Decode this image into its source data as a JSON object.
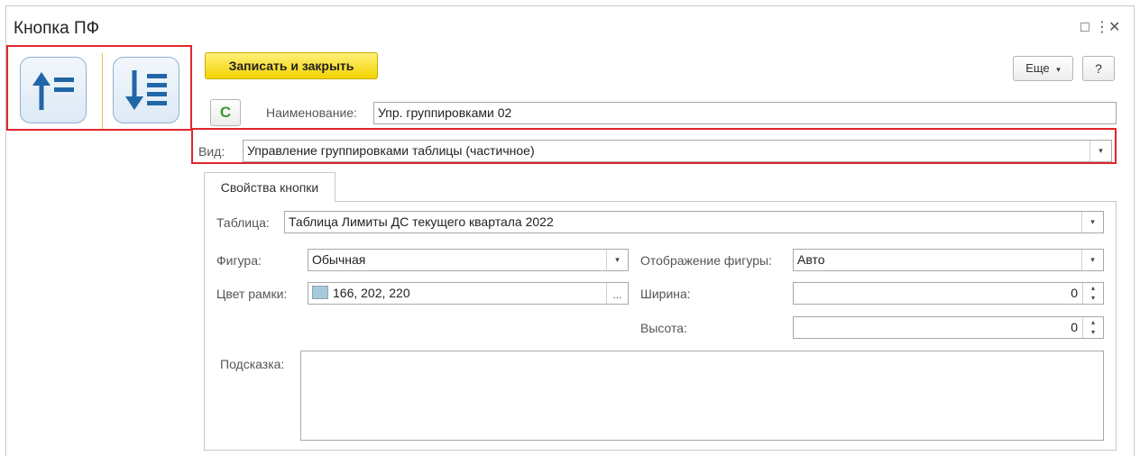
{
  "window": {
    "title": "Кнопка ПФ",
    "more_glyph": "⋮",
    "maximize_glyph": "□",
    "close_glyph": "✕"
  },
  "toolbar": {
    "save_close_label": "Записать и закрыть",
    "more_label": "Еще",
    "more_arrow": "▾",
    "help_label": "?",
    "refresh_glyph": "C"
  },
  "form": {
    "name_label": "Наименование:",
    "name_value": "Упр. группировками 02",
    "type_label": "Вид:",
    "type_value": "Управление группировками таблицы (частичное)"
  },
  "tabs": [
    {
      "label": "Свойства кнопки"
    }
  ],
  "properties": {
    "table_label": "Таблица:",
    "table_value": "Таблица Лимиты ДС текущего квартала 2022",
    "shape_label": "Фигура:",
    "shape_value": "Обычная",
    "shape_display_label": "Отображение фигуры:",
    "shape_display_value": "Авто",
    "border_color_label": "Цвет рамки:",
    "border_color_value": "166, 202, 220",
    "border_color_swatch": "#a6cadc",
    "pick_button": "...",
    "width_label": "Ширина:",
    "width_value": "0",
    "height_label": "Высота:",
    "height_value": "0",
    "hint_label": "Подсказка:",
    "hint_value": ""
  },
  "icons": {
    "sort_ascending": "sort-ascending-icon",
    "sort_descending": "sort-descending-icon",
    "dropdown_arrow": "▾",
    "spin_up": "▴",
    "spin_down": "▾"
  },
  "colors": {
    "accent_red": "#e0262b",
    "primary_yellow": "#f3d300",
    "icon_blue": "#2167a8",
    "refresh_green": "#3a9a2e"
  }
}
